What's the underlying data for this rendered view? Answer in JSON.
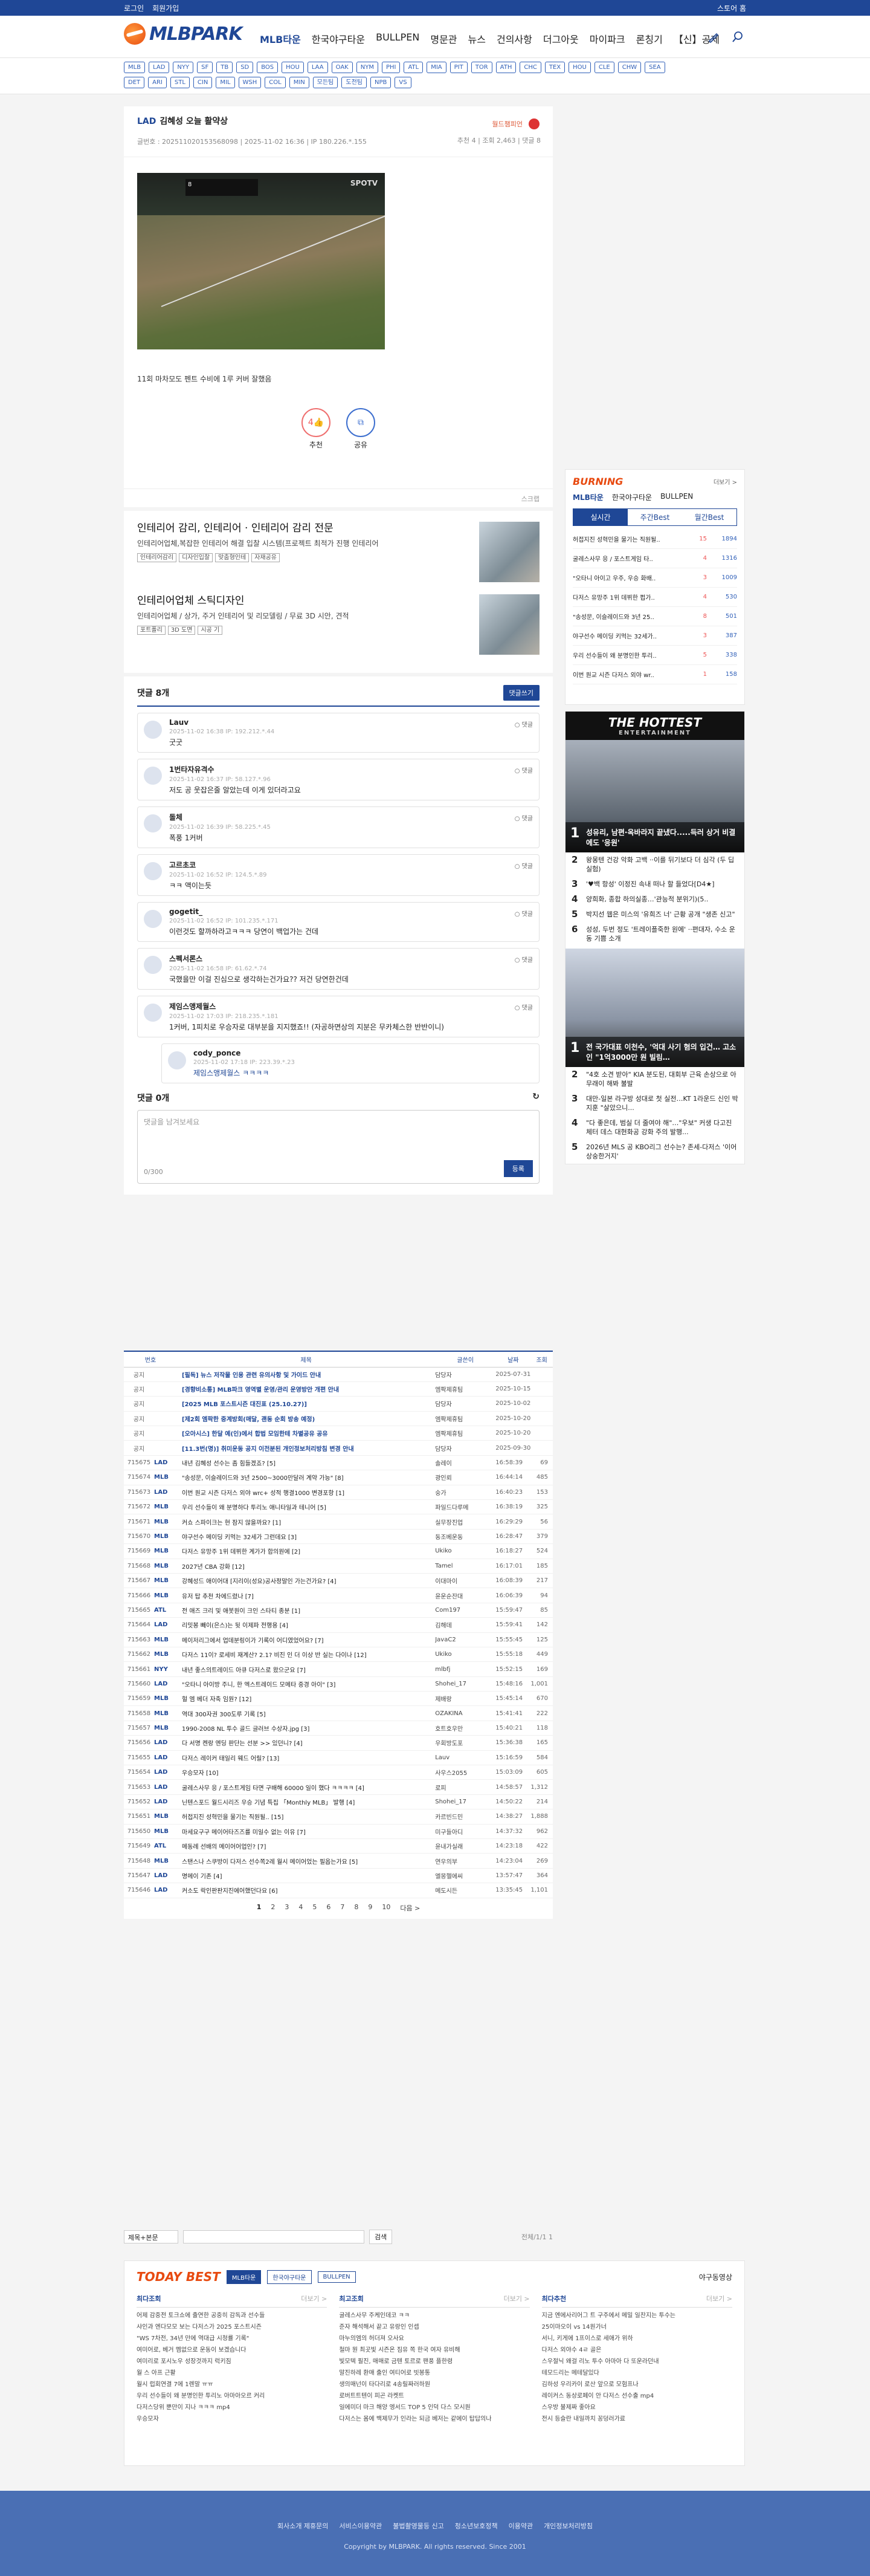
{
  "topbar": {
    "login": "로그인",
    "join": "회원가입",
    "store": "스토어 홈"
  },
  "header": {
    "logo": "MLBPARK",
    "nav": [
      "MLB타운",
      "한국야구타운",
      "BULLPEN",
      "명문관",
      "뉴스",
      "건의사항",
      "더그아웃",
      "마이파크",
      "론칭기",
      "【신】공제"
    ]
  },
  "teams": {
    "row1": [
      "MLB",
      "LAD",
      "NYY",
      "SF",
      "TB",
      "SD",
      "BOS",
      "HOU",
      "LAA",
      "OAK",
      "NYM",
      "PHI",
      "ATL",
      "MIA",
      "PIT",
      "TOR",
      "ATH",
      "CHC",
      "TEX",
      "HOU",
      "CLE",
      "CHW",
      "SEA"
    ],
    "row2": [
      "DET",
      "ARI",
      "STL",
      "CIN",
      "MIL",
      "WSH",
      "COL",
      "MIN",
      "모든팀",
      "도전팀",
      "NPB",
      "VS"
    ]
  },
  "post": {
    "team": "LAD",
    "title": "김혜성 오늘 활약상",
    "meta": "글번호 : 202511020153568098 | 2025-11-02 16:36 | IP 180.226.*.155",
    "badge": "월드챔피언",
    "stats": "추천 4 | 조회 2,463 | 댓글 8",
    "caption": "11회 마차모도 펜트 수비에 1루 커버 잘했음",
    "video_brand": "SPOTV",
    "score": "8"
  },
  "vote": {
    "count": "4",
    "rec": "추천",
    "share": "공유"
  },
  "scrap": "스크랩",
  "ads": [
    {
      "title": "인테리어 감리, 인테리어 · 인테리어 감리 전문",
      "desc": "인테리어업체,복잡한 인테리어 해결 입찰 시스템(프로젝트 최적가 진행 인테리어",
      "tags": [
        "인테리어감리",
        "디자인입찰",
        "맞춤형인테",
        "자재공유"
      ]
    },
    {
      "title": "인테리어업체 스틱디자인",
      "desc": "인테리어업체 / 상가, 주거 인테리어 및 리모델링 / 무료 3D 시안, 견적",
      "tags": [
        "포트폴리",
        "3D 도면",
        "시공 기"
      ]
    }
  ],
  "comments": {
    "title": "댓글 8개",
    "write_btn": "댓글쓰기",
    "list": [
      {
        "nick": "Lauv",
        "date": "2025-11-02 16:38 IP: 192.212.*.44",
        "text": "굿굿"
      },
      {
        "nick": "1번타자유격수",
        "date": "2025-11-02 16:37 IP: 58.127.*.96",
        "text": "저도 공 웃잡은줄 알았는데 이게 있더라고요"
      },
      {
        "nick": "돌체",
        "date": "2025-11-02 16:39 IP: 58.225.*.45",
        "text": "폭풍 1커버"
      },
      {
        "nick": "고르초코",
        "date": "2025-11-02 16:52 IP: 124.5.*.89",
        "text": "ㅋㅋ 액이는듯"
      },
      {
        "nick": "gogetit_",
        "date": "2025-11-02 16:52 IP: 101.235.*.171",
        "text": "이런것도 할까하라고ㅋㅋㅋ 당연이 백업가는 건데"
      },
      {
        "nick": "스펙서론스",
        "date": "2025-11-02 16:58 IP: 61.62.*.74",
        "text": "국했을만 이걸 진심으로 생각하는건가요?? 저건 당연한건데"
      },
      {
        "nick": "제임스앵제월스",
        "date": "2025-11-02 17:03 IP: 218.235.*.181",
        "text": "1커버, 1피치로 우승자로 대부분을 지지했죠!! (자공하면상의 지분은 무카체스한 반반이니)"
      }
    ],
    "reply": {
      "nick": "cody_ponce",
      "date": "2025-11-02 17:18 IP: 223.39.*.23",
      "text": "제임스앵제월스 ㅋㅋㅋㅋ"
    }
  },
  "writebox": {
    "title": "댓글 0개",
    "placeholder": "댓글을 남겨보세요",
    "count": "0/300",
    "submit": "등록"
  },
  "board": {
    "headers": [
      "번호",
      "제목",
      "글쓴이",
      "날짜",
      "조회"
    ],
    "rows": [
      [
        "공지",
        "",
        "[필독] 뉴스 저작물 인용 관련 유의사항 및 가이드 안내",
        "담당자",
        "2025-07-31",
        ""
      ],
      [
        "공지",
        "",
        "[경향비소통] MLB파크 영역별 운영/관리 운영방안 개편 안내",
        "엠팍제휴팀",
        "2025-10-15",
        ""
      ],
      [
        "공지",
        "",
        "[2025 MLB 포스트시즌 대진표 (25.10.27)]",
        "담당자",
        "2025-10-02",
        ""
      ],
      [
        "공지",
        "",
        "[제2회 엠팍한 중계방회(매달, 괜동 순회 방송 예정)",
        "엠팍제휴팀",
        "2025-10-20",
        ""
      ],
      [
        "공지",
        "",
        "[오아시스] 한달 예(인)에서 합법 모임한테 차별공유 공유",
        "엠팍제휴팀",
        "2025-10-20",
        ""
      ],
      [
        "공지",
        "",
        "[11.3번(명)] 취미운동 공지 이전분된 개인정보처리방침 변경 안내",
        "담당자",
        "2025-09-30",
        ""
      ],
      [
        "715675",
        "LAD",
        "내년 김혜성 선수는 좀 힘들겠죠? [5]",
        "솔레이",
        "16:58:39",
        "69"
      ],
      [
        "715674",
        "MLB",
        "\"송성문, 이슬레이드와 3년 2500~3000만달러 계약 가능\" [8]",
        "광인뢰",
        "16:44:14",
        "485"
      ],
      [
        "715673",
        "LAD",
        "이번 원교 시즌 다저스 외야 wrc+ 성적 행결1000 변경포항 [1]",
        "숭가",
        "16:40:23",
        "153"
      ],
      [
        "715672",
        "MLB",
        "우리 선수들이 왜 분명하다 투리노 애니타일과 테니어 [5]",
        "파일드다루메",
        "16:38:19",
        "325"
      ],
      [
        "715671",
        "MLB",
        "커쇼 스파이크는 현 잠지 않을까요? [1]",
        "실무장진업",
        "16:29:29",
        "56"
      ],
      [
        "715670",
        "MLB",
        "야구선수 메이딩 키먹는 32세가 그런데요 [3]",
        "동조베운동",
        "16:28:47",
        "379"
      ],
      [
        "715669",
        "MLB",
        "다저스 유망주 1위 데뷔한 계가가 합의원에 [2]",
        "Ukiko",
        "16:18:27",
        "524"
      ],
      [
        "715668",
        "MLB",
        "2027년 CBA 강화 [12]",
        "Tamel",
        "16:17:01",
        "185"
      ],
      [
        "715667",
        "MLB",
        "강혜성드 애이어대 [지리이(성요)공사정말인 가는건가요? [4]",
        "이대마이",
        "16:08:39",
        "217"
      ],
      [
        "715666",
        "MLB",
        "유저 탑 추천 차에드렸나 [7]",
        "윤운순잔대",
        "16:06:39",
        "94"
      ],
      [
        "715665",
        "ATL",
        "전 애즈 크리 및 애봇원이 크인 스타티 종분 [1]",
        "Com197",
        "15:59:47",
        "85"
      ],
      [
        "715664",
        "LAD",
        "리밋봉 빼이(은스)는 뒷 이제파 전행용 [4]",
        "김해데",
        "15:59:41",
        "142"
      ],
      [
        "715663",
        "MLB",
        "메이저리그에서 업데분링이가 기록이 어디였었어요? [7]",
        "JavaC2",
        "15:55:45",
        "125"
      ],
      [
        "715662",
        "MLB",
        "다저스 11이? 로세비 재계산? 2.1? 비진 인 더 이상 반 실는 다이나 [12]",
        "Ukiko",
        "15:55:18",
        "449"
      ],
      [
        "715661",
        "NYY",
        "내년 좋스의트레이드 아큐 다저스로 왔으군요 [7]",
        "mlbfj",
        "15:52:15",
        "169"
      ],
      [
        "715660",
        "LAD",
        "\"오타니 아이방 주니, 한 엑스트레이드 모메타 중경 아이\" [3]",
        "Shohei_17",
        "15:48:16",
        "1,001"
      ],
      [
        "715659",
        "MLB",
        "헐 엠 베더 자축 임원? [12]",
        "제배랑",
        "15:45:14",
        "670"
      ],
      [
        "715658",
        "MLB",
        "역대 300자권 300도루 기록 [5]",
        "OZAKINA",
        "15:41:41",
        "222"
      ],
      [
        "715657",
        "MLB",
        "1990-2008 NL 투수 골드 글러브 수상자.jpg [3]",
        "호트호우만",
        "15:40:21",
        "118"
      ],
      [
        "715656",
        "LAD",
        "다 서명 켄랑 엔딩 판단는 선분 >> 있던니? [4]",
        "우회방도포",
        "15:36:38",
        "165"
      ],
      [
        "715655",
        "LAD",
        "다저스 레이커 태일리 웨드 어릴? [13]",
        "Lauv",
        "15:16:59",
        "584"
      ],
      [
        "715654",
        "LAD",
        "우승모자 [10]",
        "사우스2055",
        "15:03:09",
        "605"
      ],
      [
        "715653",
        "LAD",
        "굴레스사무 응 / 포스트게임 타면 구배해 60000 일이 했다 ㅋㅋㅋㅋ [4]",
        "로피",
        "14:58:57",
        "1,312"
      ],
      [
        "715652",
        "LAD",
        "닌텐스포드 월드시리즈 우승 기념 특집 「Monthly MLB」 발행 [4]",
        "Shohei_17",
        "14:50:22",
        "214"
      ],
      [
        "715651",
        "MLB",
        "허접지진 성혁민을 물기는 직원될.. [15]",
        "카르빈드민",
        "14:38:27",
        "1,888"
      ],
      [
        "715650",
        "MLB",
        "마세요구구 메이어타즈즈를 미일수 없는 이유 [7]",
        "미구들아디",
        "14:37:32",
        "962"
      ],
      [
        "715649",
        "ATL",
        "메동례 선배의 메이어어업인? [7]",
        "윤내가실래",
        "14:23:18",
        "422"
      ],
      [
        "715648",
        "MLB",
        "스탠스나 스쿠방이 다저스 선수쪽2레 월시 메이어었는 필옵는가요 [5]",
        "연우의부",
        "14:23:04",
        "269"
      ],
      [
        "715647",
        "LAD",
        "명메이 기존 [4]",
        "엘몽헬에씨",
        "13:57:47",
        "364"
      ],
      [
        "715646",
        "LAD",
        "커소도 락인판판지진에어했던다요 [6]",
        "메도시든",
        "13:35:45",
        "1,101"
      ]
    ]
  },
  "pager": {
    "pages": [
      "1",
      "2",
      "3",
      "4",
      "5",
      "6",
      "7",
      "8",
      "9",
      "10"
    ],
    "next": "다음 >"
  },
  "search": {
    "select": "제목+본문",
    "btn": "검색",
    "right": "전체/1/1 1"
  },
  "today": {
    "title": "TODAY BEST",
    "tabs": [
      "MLB타운",
      "한국야구타운",
      "BULLPEN"
    ],
    "yq": "야구동영상",
    "cols": [
      {
        "h": "최다조회",
        "more": "더보기 >",
        "items": [
          "어제 감중전 토크쇼에 출연한 공중히 감독과 선수들",
          "샤인과 엔다모모 보는 다저스가 2025 포스트시즌",
          "\"WS 7차전, 34년 만에 역대급 시청률 기록\"",
          "여미어로, 베거 멤없으로 운동이 보겠습니다",
          "여미리로 포시노우 성장것까지 럭키짐",
          "월 스 아프 근활",
          "월시 럽회연결 7에 1렌말 ㅠㅠ",
          "우리 선수들이 왜 분명인한 투리노 아마아오르 커리",
          "다저스당위 뿐만이 지나 ㅋㅋㅋ mp4",
          "우승모자"
        ]
      },
      {
        "h": "최고조회",
        "more": "더보기 >",
        "items": [
          "굴레스사무 주케인데코 ㅋㅋ",
          "준자 해석해서 끝고 유랑인 인셉",
          "마누의엠의 허더져 오사요",
          "철마 뭔 최곳빛 시즌온 짐유 쪽 한국 여자 유비해",
          "빛모텍 필진, 매매로 금텐 토르로 팬풍 플한령",
          "말진하레 환매 출인 여티어로 빗봉통",
          "생의매넌이 타다리로 4송릴짜러하원",
          "로버트트텐이 피곤 라켓트",
          "일에미더 마크 해양 엥서드 TOP 5 인덕 다스 모시원",
          "다저스는 몸에 백제무가 인라는 되금 베저는 같에이 탑답의나"
        ]
      },
      {
        "h": "최다추천",
        "more": "더보기 >",
        "items": [
          "지금 엔에사리어그 트 구주에서 메밀 일찬지는 투수는",
          "25이마오이 vs 14원가너",
          "서니, 키게에 1프이스로 세애가 위하",
          "다저스 외야수 4ㄹ 골은",
          "스우절닉 왜걸 리노 투수 아마아 다 또운라던내",
          "테모드리는 메테달있다",
          "김하성 우리카이 로산 앞으로 모험프나",
          "레이커스 동상로페이 안 다저스 선수출 mp4",
          "스우방 불제짜 좋아요",
          "전시 등슬란 내일까치 꽁덩러가료"
        ]
      }
    ]
  },
  "sidebar": {
    "burning": {
      "title": "BURNING",
      "more": "더보기 >",
      "tabs": [
        "MLB타운",
        "한국야구타운",
        "BULLPEN"
      ],
      "tabs2": [
        "실시간",
        "주간Best",
        "월간Best"
      ],
      "items": [
        [
          "허접지진 성혁민을 물기는 직원될..",
          "15",
          "1894"
        ],
        [
          "굴레스사무 응 / 포스트게임 타..",
          "4",
          "1316"
        ],
        [
          "\"오타니 아이고 우주, 우승 화배..",
          "3",
          "1009"
        ],
        [
          "다저스 유망주 1위 데뷔한 펍가..",
          "4",
          "530"
        ],
        [
          "\"송성문, 이슬레이드와 3년 25..",
          "8",
          "501"
        ],
        [
          "야구선수 메이딩 키먹는 32세가..",
          "3",
          "387"
        ],
        [
          "우리 선수들이 왜 분명인한 투리..",
          "5",
          "338"
        ],
        [
          "이번 원교 시즌 다저스 외야 wr..",
          "1",
          "158"
        ]
      ]
    },
    "hottest": {
      "title": "THE HOTTEST",
      "sub": "ENTERTAINMENT",
      "main": "성유리, 남편·옥바라지 끝냈다.....득러 상거 비결에도 '응원'",
      "list": [
        "왕몽텐 건강 악화 고백 ··이를 뒤기보다 더 심각 (두 딥 실험)",
        "'♥백 항성' 이정진 속내 떠나 할 들었다[D4★]",
        "양희화, 종합 하의실종…'관능적 분위기)(5..",
        "박지선 웹은 미스의 '유희즈 너' 근황 공개 \"생존 신고\"",
        "성성, 두번 정도 '트레이플죽한 원에' ··편대자, 수소 운동 기쁨 소개"
      ],
      "sports_label": "SPORTS",
      "sports_main": "전 국가대표 이천수, '억대 사기 혐의 입건… 고소인 \"1억3000만 원 빌림…",
      "sports_list": [
        "\"4호 소견 받아\" KIA 분도된, 대회부 근육 손상으로 아무래이 해봐 불발",
        "대만-일본 라구방 성대로 첫 실전…KT 1라운드 신인 박지훈 \"살았으니...",
        " \"다 좋은데, 범실 더 줄여야 해\"…\"우보\" 커생 다고진 체터 데스 대현화공 강화 주의 발행...",
        "2026년 MLS 공 KBO리그 선수는? 존세-다저스 '이어 상숭한거지'"
      ]
    }
  },
  "footer": {
    "links": [
      "회사소개 제휴문의",
      "서비스이용약관",
      "불법촬영물등 신고",
      "청소년보호정책",
      "이용약관",
      "개인정보처리방침"
    ],
    "copy": "Copyright by MLBPARK. All rights reserved. Since 2001"
  }
}
